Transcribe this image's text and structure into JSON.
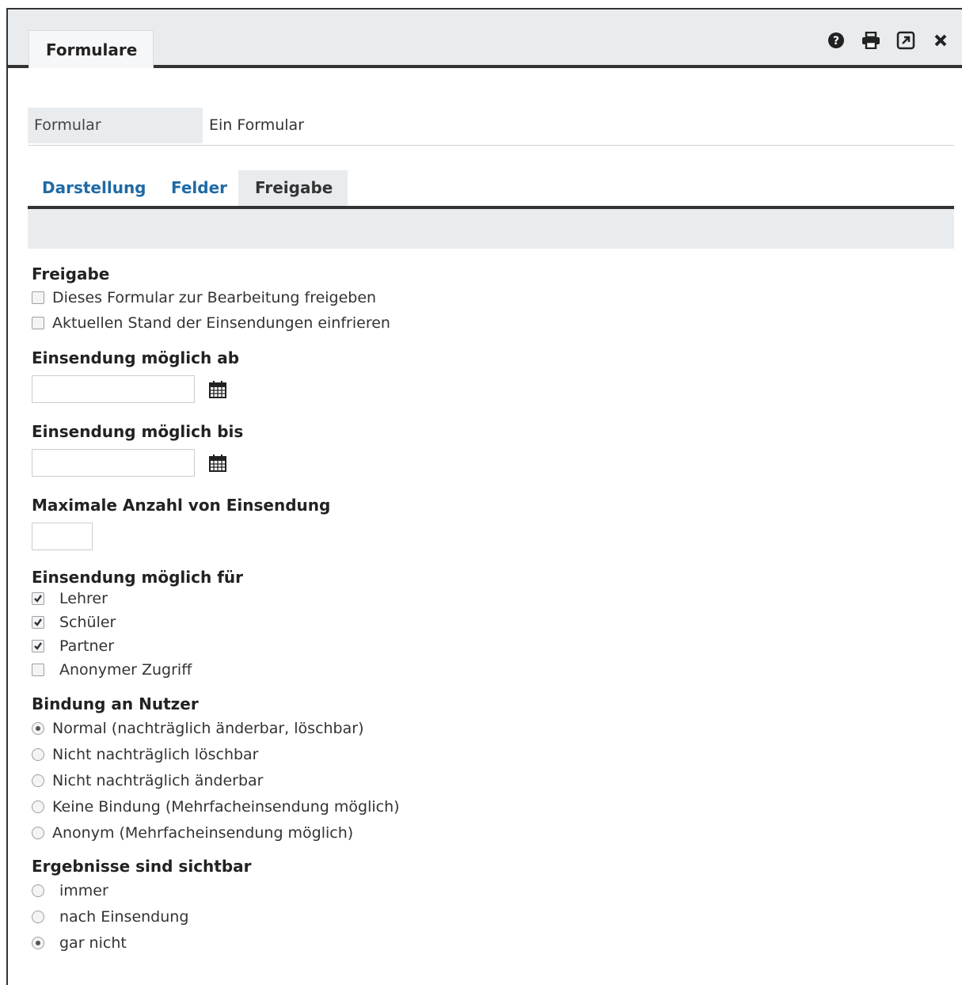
{
  "window": {
    "title": "Formulare",
    "icons": [
      "help-icon",
      "print-icon",
      "external-link-icon",
      "close-icon"
    ]
  },
  "form": {
    "label": "Formular",
    "value": "Ein Formular"
  },
  "tabs": [
    {
      "label": "Darstellung",
      "active": false
    },
    {
      "label": "Felder",
      "active": false
    },
    {
      "label": "Freigabe",
      "active": true
    }
  ],
  "freigabe": {
    "title": "Freigabe",
    "options": [
      {
        "label": "Dieses Formular zur Bearbeitung freigeben",
        "checked": false
      },
      {
        "label": "Aktuellen Stand der Einsendungen einfrieren",
        "checked": false
      }
    ]
  },
  "from": {
    "title": "Einsendung möglich ab",
    "value": ""
  },
  "until": {
    "title": "Einsendung möglich bis",
    "value": ""
  },
  "max": {
    "title": "Maximale Anzahl von Einsendung",
    "value": ""
  },
  "audience": {
    "title": "Einsendung möglich für",
    "options": [
      {
        "label": "Lehrer",
        "checked": true
      },
      {
        "label": "Schüler",
        "checked": true
      },
      {
        "label": "Partner",
        "checked": true
      },
      {
        "label": "Anonymer Zugriff",
        "checked": false
      }
    ]
  },
  "binding": {
    "title": "Bindung an Nutzer",
    "options": [
      {
        "label": "Normal (nachträglich änderbar, löschbar)",
        "selected": true
      },
      {
        "label": "Nicht nachträglich löschbar",
        "selected": false
      },
      {
        "label": "Nicht nachträglich änderbar",
        "selected": false
      },
      {
        "label": "Keine Bindung (Mehrfacheinsendung möglich)",
        "selected": false
      },
      {
        "label": "Anonym (Mehrfacheinsendung möglich)",
        "selected": false
      }
    ]
  },
  "results": {
    "title": "Ergebnisse sind sichtbar",
    "options": [
      {
        "label": "immer",
        "selected": false
      },
      {
        "label": "nach Einsendung",
        "selected": false
      },
      {
        "label": "gar nicht",
        "selected": true
      }
    ]
  },
  "colors": {
    "link": "#1f6aa5",
    "panel": "#e9ecef",
    "border": "#333333"
  }
}
